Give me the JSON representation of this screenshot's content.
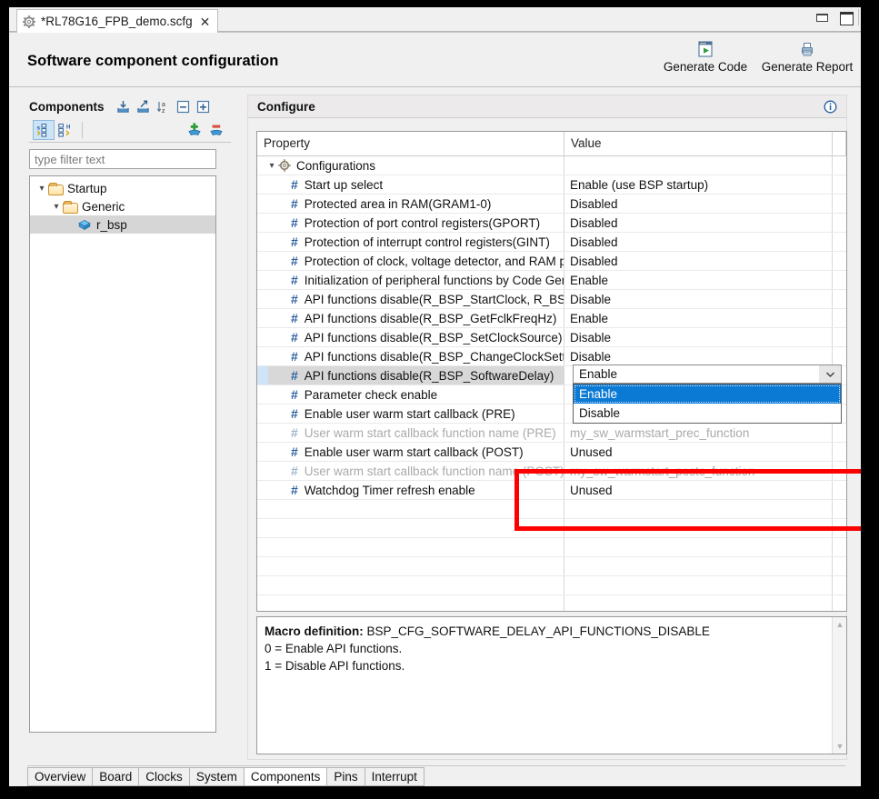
{
  "window": {
    "editor_tab": {
      "icon": "gear-icon",
      "title": "*RL78G16_FPB_demo.scfg",
      "close": "✕"
    },
    "controls": {
      "minimize": "minimize-icon",
      "maximize": "maximize-icon"
    }
  },
  "header": {
    "title": "Software component configuration",
    "actions": [
      {
        "icon": "generate-code-icon",
        "label": "Generate Code"
      },
      {
        "icon": "generate-report-icon",
        "label": "Generate Report"
      }
    ]
  },
  "components_panel": {
    "title": "Components",
    "header_tools": [
      {
        "name": "import-icon",
        "tip": "Import"
      },
      {
        "name": "export-icon",
        "tip": "Export"
      },
      {
        "name": "sort-az-icon",
        "tip": "Sort"
      },
      {
        "name": "collapse-all-icon",
        "tip": "Collapse All"
      },
      {
        "name": "expand-all-icon",
        "tip": "Expand All"
      }
    ],
    "toolbar": [
      {
        "name": "group-by-component-icon",
        "active": true
      },
      {
        "name": "group-by-type-icon",
        "active": false
      },
      {
        "name": "add-component-icon",
        "active": false
      },
      {
        "name": "remove-component-icon",
        "active": false
      }
    ],
    "filter": {
      "placeholder": "type filter text",
      "value": ""
    },
    "tree": [
      {
        "label": "Startup",
        "level": 0,
        "expanded": true,
        "icon": "folder-icon",
        "selected": false
      },
      {
        "label": "Generic",
        "level": 1,
        "expanded": true,
        "icon": "folder-icon",
        "selected": false
      },
      {
        "label": "r_bsp",
        "level": 2,
        "expanded": null,
        "icon": "component-icon",
        "selected": true
      }
    ]
  },
  "configure_panel": {
    "title": "Configure",
    "info_icon": "info-icon",
    "table": {
      "columns": [
        "Property",
        "Value"
      ],
      "rows": [
        {
          "kind": "group",
          "icon": "configurations-icon",
          "property": "Configurations",
          "value": "",
          "expanded": true
        },
        {
          "kind": "item",
          "property": "Start up select",
          "value": "Enable (use BSP startup)"
        },
        {
          "kind": "item",
          "property": "Protected area in RAM(GRAM1-0)",
          "value": "Disabled"
        },
        {
          "kind": "item",
          "property": "Protection of port control registers(GPORT)",
          "value": "Disabled"
        },
        {
          "kind": "item",
          "property": "Protection of interrupt control registers(GINT)",
          "value": "Disabled"
        },
        {
          "kind": "item",
          "property": "Protection of clock, voltage detector, and RAM parity error detector(GCSC)",
          "value": "Disabled"
        },
        {
          "kind": "item",
          "property": "Initialization of peripheral functions by Code Generator",
          "value": "Enable"
        },
        {
          "kind": "item",
          "property": "API functions disable(R_BSP_StartClock, R_BSP_StopClock)",
          "value": "Disable"
        },
        {
          "kind": "item",
          "property": "API functions disable(R_BSP_GetFclkFreqHz)",
          "value": "Enable"
        },
        {
          "kind": "item",
          "property": "API functions disable(R_BSP_SetClockSource)",
          "value": "Disable"
        },
        {
          "kind": "item",
          "property": "API functions disable(R_BSP_ChangeClockSetting)",
          "value": "Disable"
        },
        {
          "kind": "item",
          "property": "API functions disable(R_BSP_SoftwareDelay)",
          "value": "Enable",
          "selected": true
        },
        {
          "kind": "item",
          "property": "Parameter check enable",
          "value": ""
        },
        {
          "kind": "item",
          "property": "Enable user warm start callback (PRE)",
          "value": ""
        },
        {
          "kind": "item",
          "property": "User warm start callback  function name (PRE)",
          "value": "my_sw_warmstart_prec_function",
          "disabled": true
        },
        {
          "kind": "item",
          "property": "Enable user warm start callback (POST)",
          "value": "Unused"
        },
        {
          "kind": "item",
          "property": "User warm start callback  function name (POST)",
          "value": "my_sw_warmstart_postc_function",
          "disabled": true
        },
        {
          "kind": "item",
          "property": "Watchdog Timer refresh enable",
          "value": "Unused"
        },
        {
          "kind": "blank",
          "property": "",
          "value": ""
        },
        {
          "kind": "blank",
          "property": "",
          "value": ""
        },
        {
          "kind": "blank",
          "property": "",
          "value": ""
        },
        {
          "kind": "blank",
          "property": "",
          "value": ""
        },
        {
          "kind": "blank",
          "property": "",
          "value": ""
        },
        {
          "kind": "blank",
          "property": "",
          "value": ""
        },
        {
          "kind": "blank",
          "property": "",
          "value": ""
        }
      ]
    },
    "dropdown": {
      "value": "Enable",
      "arrow": "chevron-down-icon",
      "options": [
        {
          "label": "Enable",
          "selected": true
        },
        {
          "label": "Disable",
          "selected": false
        }
      ]
    },
    "annotation": {
      "color": "#fe0000"
    },
    "macro": {
      "label": "Macro definition:",
      "name": "BSP_CFG_SOFTWARE_DELAY_API_FUNCTIONS_DISABLE",
      "lines": [
        "0 = Enable API functions.",
        "1 = Disable API functions."
      ],
      "scroll_up": "▲",
      "scroll_down": "▼"
    }
  },
  "bottom_tabs": [
    {
      "label": "Overview",
      "active": false
    },
    {
      "label": "Board",
      "active": false
    },
    {
      "label": "Clocks",
      "active": false
    },
    {
      "label": "System",
      "active": false
    },
    {
      "label": "Components",
      "active": true
    },
    {
      "label": "Pins",
      "active": false
    },
    {
      "label": "Interrupt",
      "active": false
    }
  ]
}
